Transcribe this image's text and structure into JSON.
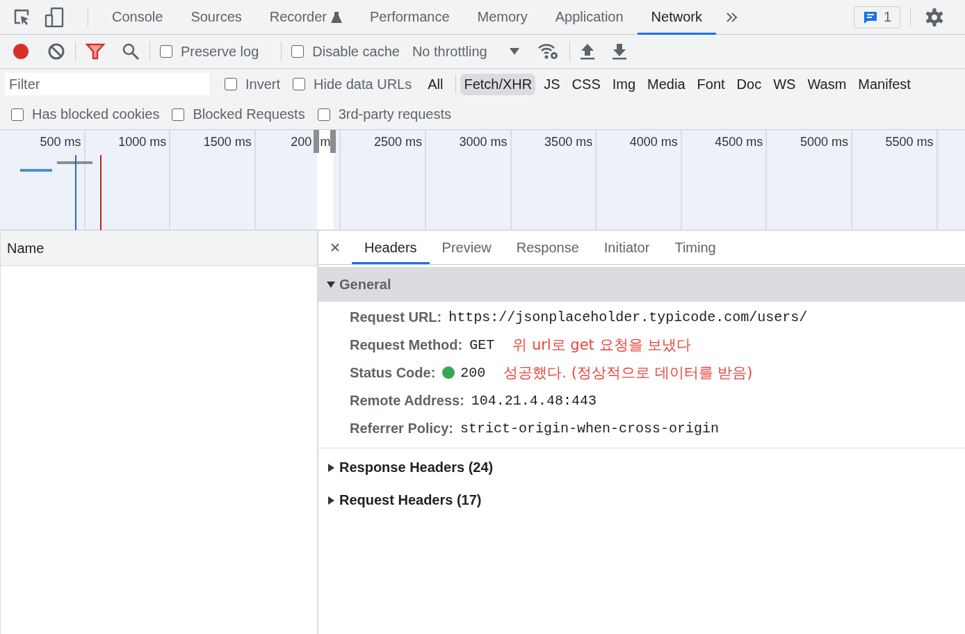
{
  "main_tabs": [
    {
      "label": "Console",
      "selected": false,
      "kind": "plain"
    },
    {
      "label": "Sources",
      "selected": false,
      "kind": "plain"
    },
    {
      "label": "Recorder",
      "selected": false,
      "kind": "experimental"
    },
    {
      "label": "Performance",
      "selected": false,
      "kind": "plain"
    },
    {
      "label": "Memory",
      "selected": false,
      "kind": "plain"
    },
    {
      "label": "Application",
      "selected": false,
      "kind": "plain"
    },
    {
      "label": "Network",
      "selected": true,
      "kind": "plain"
    }
  ],
  "issues_count": "1",
  "toolbar": {
    "recording": true,
    "checkboxes": [
      {
        "label": "Preserve log",
        "checked": false
      },
      {
        "label": "Disable cache",
        "checked": false
      }
    ],
    "throttling": "No throttling"
  },
  "filter": {
    "placeholder": "Filter",
    "checkboxes": [
      {
        "label": "Invert",
        "checked": false
      },
      {
        "label": "Hide data URLs",
        "checked": false
      }
    ],
    "types": [
      {
        "label": "All",
        "selected": false
      },
      {
        "label": "Fetch/XHR",
        "selected": true
      },
      {
        "label": "JS",
        "selected": false
      },
      {
        "label": "CSS",
        "selected": false
      },
      {
        "label": "Img",
        "selected": false
      },
      {
        "label": "Media",
        "selected": false
      },
      {
        "label": "Font",
        "selected": false
      },
      {
        "label": "Doc",
        "selected": false
      },
      {
        "label": "WS",
        "selected": false
      },
      {
        "label": "Wasm",
        "selected": false
      },
      {
        "label": "Manifest",
        "selected": false
      }
    ],
    "more_checkboxes": [
      {
        "label": "Has blocked cookies",
        "checked": false
      },
      {
        "label": "Blocked Requests",
        "checked": false
      },
      {
        "label": "3rd-party requests",
        "checked": false
      }
    ]
  },
  "timeline": {
    "ticks": [
      "500 ms",
      "1000 ms",
      "1500 ms",
      "200",
      "2500 ms",
      "3000 ms",
      "3500 ms",
      "4000 ms",
      "4500 ms",
      "5000 ms",
      "5500 ms"
    ],
    "window_text": "m"
  },
  "requests": {
    "columns": [
      "Name"
    ]
  },
  "details": {
    "tabs": [
      {
        "label": "Headers",
        "selected": true
      },
      {
        "label": "Preview",
        "selected": false
      },
      {
        "label": "Response",
        "selected": false
      },
      {
        "label": "Initiator",
        "selected": false
      },
      {
        "label": "Timing",
        "selected": false
      }
    ],
    "general": {
      "title": "General",
      "expanded": true,
      "rows": [
        {
          "label": "Request URL:",
          "value": "https://jsonplaceholder.typicode.com/users/"
        },
        {
          "label": "Request Method:",
          "value": "GET",
          "note": "위 url로 get 요청을 보냈다"
        },
        {
          "label": "Status Code:",
          "value": "200",
          "color": "#34a853",
          "note": "성공했다. (정상적으로 데이터를 받음)"
        },
        {
          "label": "Remote Address:",
          "value": "104.21.4.48:443"
        },
        {
          "label": "Referrer Policy:",
          "value": "strict-origin-when-cross-origin"
        }
      ]
    },
    "sections": [
      {
        "title": "Response Headers (24)",
        "expanded": false
      },
      {
        "title": "Request Headers (17)",
        "expanded": false
      }
    ]
  }
}
